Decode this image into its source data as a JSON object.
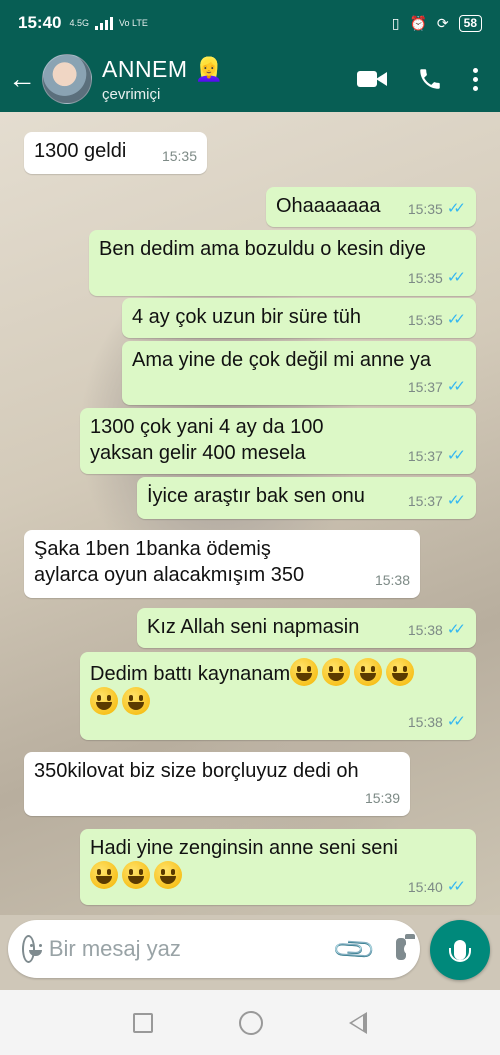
{
  "status_bar": {
    "time": "15:40",
    "network_top": "4.5G",
    "network_bottom": "Vo LTE",
    "battery": "58",
    "extra_icons": [
      "vibrate-icon",
      "alarm-icon",
      "lock-rotation-icon"
    ]
  },
  "header": {
    "name": "ANNEM",
    "name_emoji": "👱‍♀️",
    "status": "çevrimiçi",
    "icons": [
      "back-arrow-icon",
      "avatar",
      "video-call-icon",
      "phone-icon",
      "more-options-icon"
    ]
  },
  "messages": [
    {
      "direction": "in",
      "text": "1300 geldi",
      "time": "15:35"
    },
    {
      "direction": "out",
      "text": "Ohaaaaaaa",
      "time": "15:35",
      "read": true
    },
    {
      "direction": "out",
      "text": "Ben dedim ama bozuldu o kesin diye",
      "time": "15:35",
      "read": true
    },
    {
      "direction": "out",
      "text": "4 ay çok uzun bir süre tüh",
      "time": "15:35",
      "read": true
    },
    {
      "direction": "out",
      "text": "Ama yine de çok değil mi anne ya",
      "time": "15:37",
      "read": true
    },
    {
      "direction": "out",
      "text": "1300 çok yani 4 ay da 100 yaksan gelir 400 mesela",
      "time": "15:37",
      "read": true
    },
    {
      "direction": "out",
      "text": "İyice araştır bak sen onu",
      "time": "15:37",
      "read": true
    },
    {
      "direction": "in",
      "text": "Şaka  1ben 1banka ödemiş aylarca oyun alacakmışım 350",
      "time": "15:38"
    },
    {
      "direction": "out",
      "text": "Kız Allah seni napmasin",
      "time": "15:38",
      "read": true
    },
    {
      "direction": "out",
      "text": "Dedim battı kaynanam",
      "emoji_count": 6,
      "time": "15:38",
      "read": true
    },
    {
      "direction": "in",
      "text": "350kilovat biz size borçluyuz dedi oh",
      "time": "15:39"
    },
    {
      "direction": "out",
      "text": "Hadi yine zenginsin anne seni seni",
      "emoji_count": 3,
      "time": "15:40",
      "read": true
    }
  ],
  "composer": {
    "placeholder": "Bir mesaj yaz",
    "icons": [
      "emoji-icon",
      "attach-icon",
      "camera-icon",
      "mic-icon"
    ]
  },
  "colors": {
    "header": "#075e54",
    "outgoing_bubble": "#dcf8c6",
    "incoming_bubble": "#ffffff",
    "read_ticks": "#34b7f1",
    "mic_button": "#00897b"
  }
}
